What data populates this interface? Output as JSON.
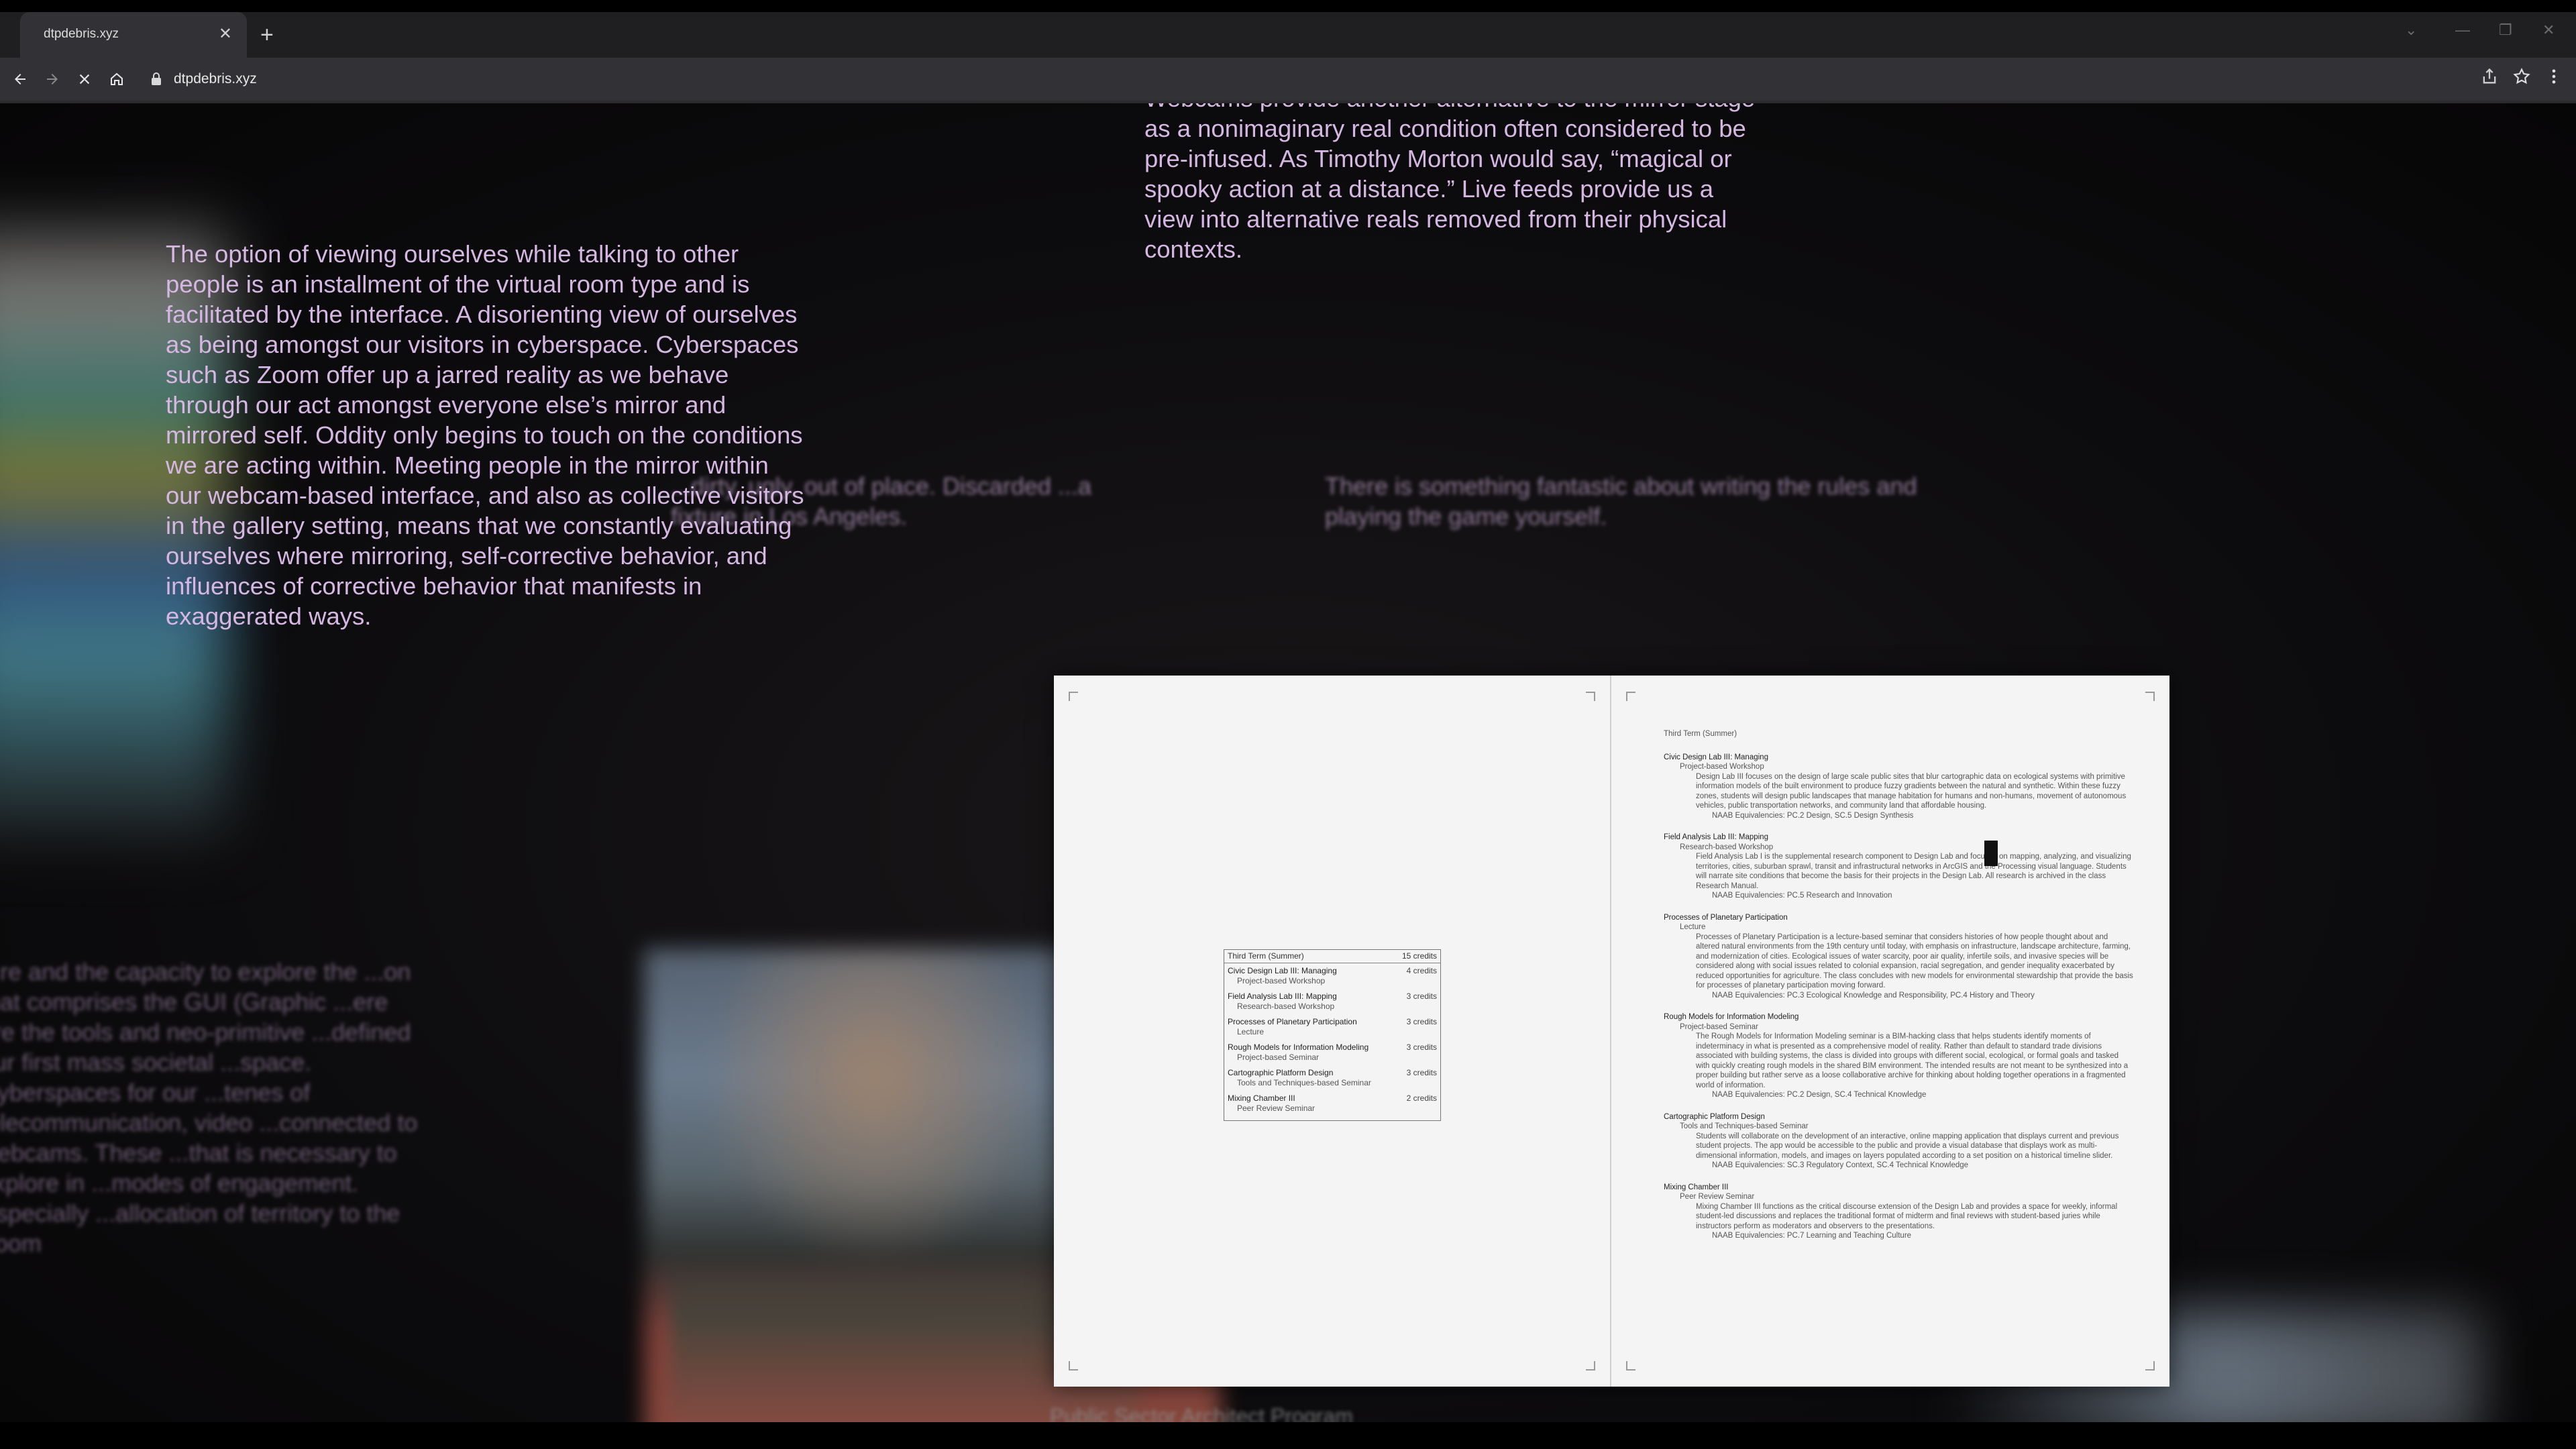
{
  "browser": {
    "tab_title": "dtpdebris.xyz",
    "url": "dtpdebris.xyz"
  },
  "page": {
    "top_paragraph": "Webcams provide another alternative to the mirror stage as a nonimaginary real condition often considered to be pre-infused. As Timothy Morton would say, “magical or spooky action at a distance.” Live feeds provide us a view into alternative reals removed from their physical contexts.",
    "left_paragraph": "The option of viewing ourselves while talking to other people is an installment of the virtual room type and is facilitated by the interface. A disorienting view of ourselves as being amongst our visitors in cyberspace. Cyberspaces such as Zoom offer up a jarred reality as we behave through our act amongst everyone else’s mirror and mirrored self. Oddity only begins to touch on the conditions we are acting within. Meeting people in the mirror within our webcam-based interface, and also as collective visitors in the gallery setting, means that we constantly evaluating ourselves where mirroring, self-corrective behavior, and influences of corrective behavior that manifests in exaggerated ways.",
    "blurred_center": "...dirty, ugly, out of place. Discarded ...a fixture in Los Angeles.",
    "blurred_right": "There is something fantastic about writing the rules and playing the game yourself.",
    "blurred_left_bottom": "...re and the capacity to explore the ...on that comprises the GUI (Graphic ...ere are the tools and neo-primitive ...defined our first mass societal ...space. Cyberspaces for our ...tenes of telecommunication, video ...connected to webcams. These ...that is necessary to explore in ...modes of engagement. Especially ...allocation of territory to the Zoom",
    "blurred_bottom_caption": "Public Sector Architect Program"
  },
  "document": {
    "summary": {
      "term": "Third Term (Summer)",
      "total": "15 credits",
      "rows": [
        {
          "course": "Civic Design Lab III: Managing",
          "type": "Project-based Workshop",
          "credits": "4 credits"
        },
        {
          "course": "Field Analysis Lab III: Mapping",
          "type": "Research-based Workshop",
          "credits": "3 credits"
        },
        {
          "course": "Processes of Planetary Participation",
          "type": "Lecture",
          "credits": "3 credits"
        },
        {
          "course": "Rough Models for Information Modeling",
          "type": "Project-based Seminar",
          "credits": "3 credits"
        },
        {
          "course": "Cartographic Platform Design",
          "type": "Tools and Techniques-based Seminar",
          "credits": "3 credits"
        },
        {
          "course": "Mixing Chamber III",
          "type": "Peer Review Seminar",
          "credits": "2 credits"
        }
      ]
    },
    "detail": {
      "term": "Third Term (Summer)",
      "courses": [
        {
          "course": "Civic Design Lab III: Managing",
          "type": "Project-based Workshop",
          "desc": "Design Lab III focuses on the design of large scale public sites that blur cartographic data on ecological systems with primitive information models of the built environment to produce fuzzy gradients between the natural and synthetic. Within these fuzzy zones, students will design public landscapes that manage habitation for humans and non-humans, movement of autonomous vehicles, public transportation networks, and community land that affordable housing.",
          "naab": "NAAB Equivalencies: PC.2 Design, SC.5 Design Synthesis"
        },
        {
          "course": "Field Analysis Lab III: Mapping",
          "type": "Research-based Workshop",
          "desc": "Field Analysis Lab I is the supplemental research component to Design Lab and focuses on mapping, analyzing, and visualizing territories, cities, suburban sprawl, transit and infrastructural networks in ArcGIS and the Processing visual language. Students will narrate site conditions that become the basis for their projects in the Design Lab. All research is archived in the class Research Manual.",
          "naab": "NAAB Equivalencies: PC.5 Research and Innovation"
        },
        {
          "course": "Processes of Planetary Participation",
          "type": "Lecture",
          "desc": "Processes of Planetary Participation is a lecture-based seminar that considers histories of how people thought about and altered natural environments from the 19th century until today, with emphasis on infrastructure, landscape architecture, farming, and modernization of cities. Ecological issues of water scarcity, poor air quality, infertile soils, and invasive species will be considered along with social issues related to colonial expansion, racial segregation, and gender inequality exacerbated by reduced opportunities for agriculture. The class concludes with new models for environmental stewardship that provide the basis for processes of planetary participation moving forward.",
          "naab": "NAAB Equivalencies: PC.3 Ecological Knowledge and Responsibility, PC.4 History and Theory"
        },
        {
          "course": "Rough Models for Information Modeling",
          "type": "Project-based Seminar",
          "desc": "The Rough Models for Information Modeling seminar is a BIM-hacking class that helps students identify moments of indeterminacy in what is presented as a comprehensive model of reality. Rather than default to standard trade divisions associated with building systems, the class is divided into groups with different social, ecological, or formal goals and tasked with quickly creating rough models in the shared BIM environment. The intended results are not meant to be synthesized into a proper building but rather serve as a loose collaborative archive for thinking about holding together operations in a fragmented world of information.",
          "naab": "NAAB Equivalencies: PC.2 Design, SC.4 Technical Knowledge"
        },
        {
          "course": "Cartographic Platform Design",
          "type": "Tools and Techniques-based Seminar",
          "desc": "Students will collaborate on the development of an interactive, online mapping application that displays current and previous student projects. The app would be accessible to the public and provide a visual database that displays work as multi-dimensional information, models, and images on layers populated according to a set position on a historical timeline slider.",
          "naab": "NAAB Equivalencies: SC.3 Regulatory Context, SC.4 Technical Knowledge"
        },
        {
          "course": "Mixing Chamber III",
          "type": "Peer Review Seminar",
          "desc": "Mixing Chamber III functions as the critical discourse extension of the Design Lab and provides a space for weekly, informal student-led discussions and replaces the traditional format of midterm and final reviews with student-based juries while instructors perform as moderators and observers to the presentations.",
          "naab": "NAAB Equivalencies: PC.7 Learning and Teaching Culture"
        }
      ]
    }
  }
}
